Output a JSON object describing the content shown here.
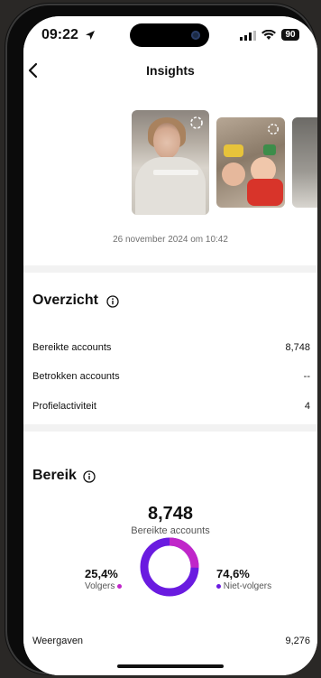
{
  "status_bar": {
    "time": "09:22",
    "battery": "90"
  },
  "nav": {
    "title": "Insights"
  },
  "media": {
    "timestamp": "26 november 2024 om 10:42"
  },
  "overview": {
    "title": "Overzicht",
    "rows": [
      {
        "label": "Bereikte accounts",
        "value": "8,748"
      },
      {
        "label": "Betrokken accounts",
        "value": "--"
      },
      {
        "label": "Profielactiviteit",
        "value": "4"
      }
    ]
  },
  "reach": {
    "title": "Bereik",
    "total": "8,748",
    "total_label": "Bereikte accounts",
    "followers_pct": "25,4%",
    "followers_label": "Volgers",
    "non_followers_pct": "74,6%",
    "non_followers_label": "Niet-volgers",
    "followers_fraction": 0.254,
    "followers_color": "#c026c9",
    "non_followers_color": "#6a1be0",
    "views_label": "Weergaven",
    "views_value": "9,276"
  }
}
